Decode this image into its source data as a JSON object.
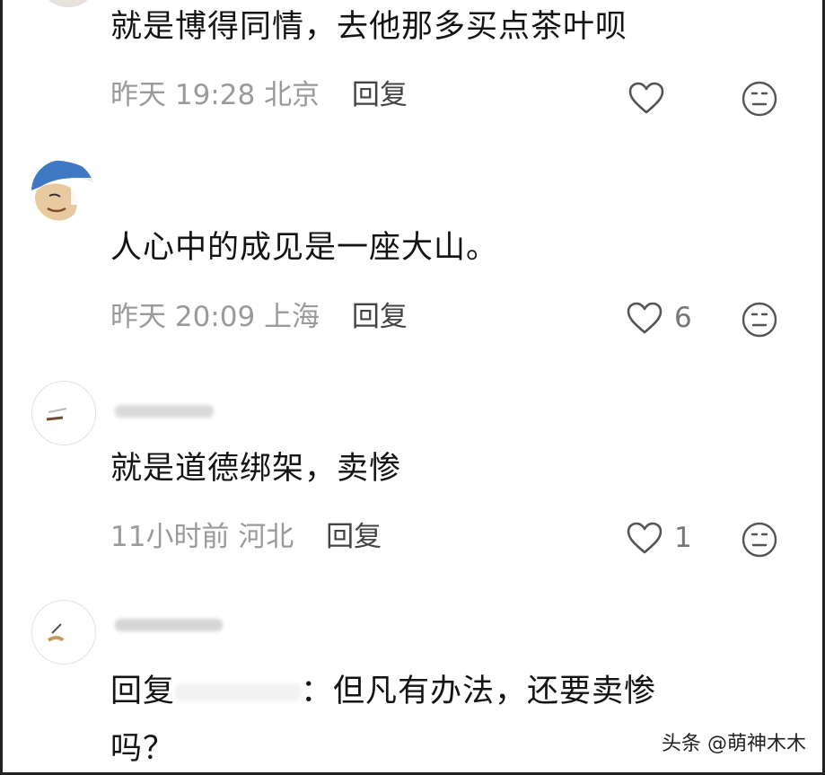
{
  "comments": [
    {
      "text": "就是博得同情，去他那多买点茶叶呗",
      "time": "昨天 19:28",
      "location": "北京",
      "reply_label": "回复",
      "likes": ""
    },
    {
      "text": "人心中的成见是一座大山。",
      "time": "昨天 20:09",
      "location": "上海",
      "reply_label": "回复",
      "likes": "6"
    },
    {
      "text": "就是道德绑架，卖惨",
      "time": "11小时前",
      "location": "河北",
      "reply_label": "回复",
      "likes": "1"
    },
    {
      "text_prefix": "回复",
      "text_suffix": "：但凡有办法，还要卖惨",
      "text_line2": "吗？"
    }
  ],
  "watermark": "头条 @萌神木木",
  "icons": {
    "like": "heart-outline-icon",
    "emoji": "neutral-face-icon"
  },
  "colors": {
    "text": "#141414",
    "meta": "#9a9a9a",
    "reply": "#444444",
    "icon": "#555555"
  }
}
